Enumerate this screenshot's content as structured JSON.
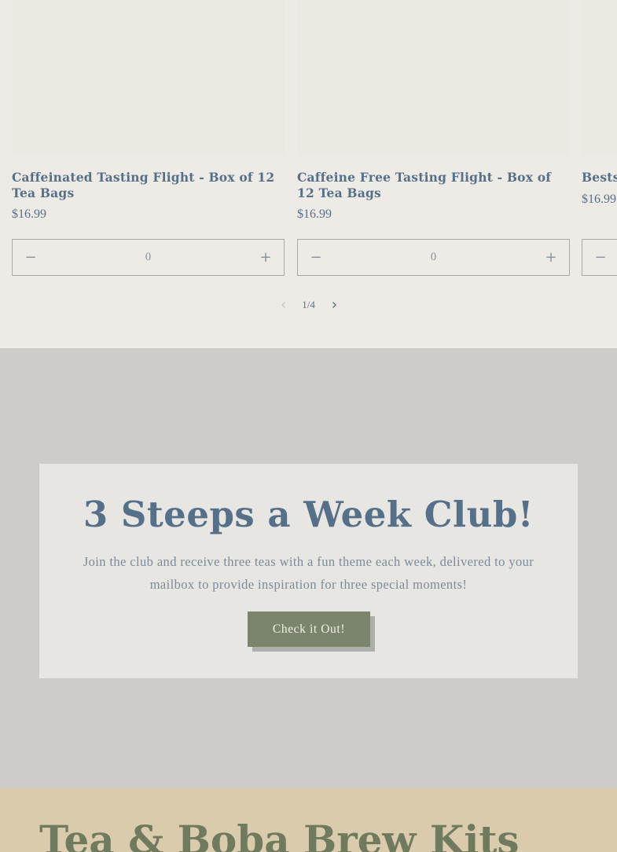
{
  "products": [
    {
      "title": "Caffeinated Tasting Flight - Box of 12 Tea Bags",
      "price": "$16.99",
      "quantity": "0"
    },
    {
      "title": "Caffeine Free Tasting Flight - Box of 12 Tea Bags",
      "price": "$16.99",
      "quantity": "0"
    },
    {
      "title": "Bests",
      "price": "$16.99",
      "quantity": "0"
    }
  ],
  "qty_controls": {
    "minus": "−",
    "plus": "+"
  },
  "pager": {
    "current": "1",
    "separator": "/",
    "total": "4",
    "prev_icon": "chevron-left-icon",
    "next_icon": "chevron-right-icon"
  },
  "club": {
    "title": "3 Steeps a Week Club!",
    "text": "Join the club and receive three teas with a fun theme each week, delivered to your mailbox to provide inspiration for three special moments!",
    "button_label": "Check it Out!"
  },
  "brew": {
    "title": "Tea & Boba Brew Kits"
  },
  "colors": {
    "page_bg": "#eeebe6",
    "accent_blue": "#56708a",
    "club_bg": "#cdccc9",
    "club_box": "#e7e6e3",
    "button": "#7b846c",
    "brew_bg": "#dbcbad",
    "brew_title": "#707a5e"
  }
}
